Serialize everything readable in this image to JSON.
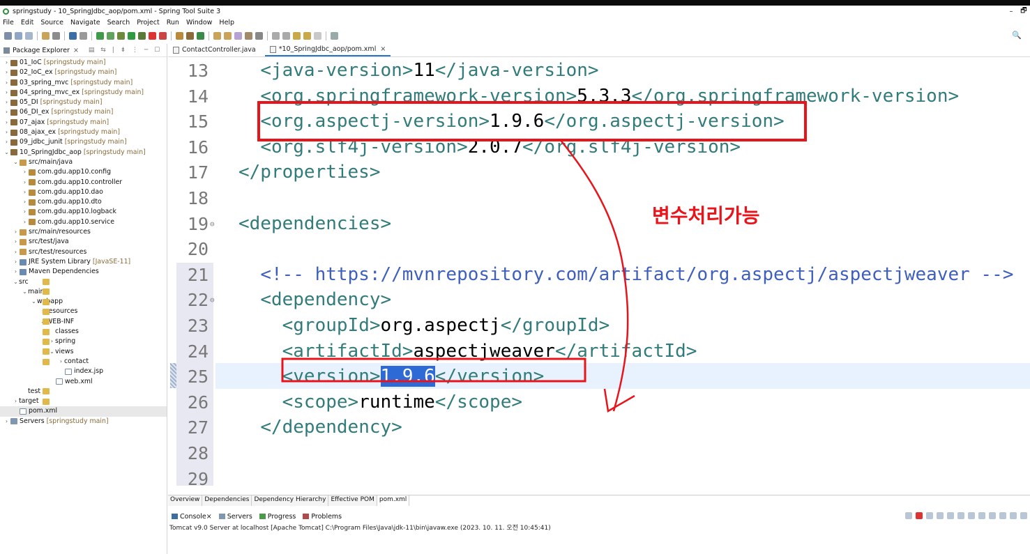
{
  "window": {
    "title": "springstudy - 10_SpringJdbc_aop/pom.xml - Spring Tool Suite 3",
    "minimize": "–",
    "restore": "🗗"
  },
  "menu": [
    "File",
    "Edit",
    "Source",
    "Navigate",
    "Search",
    "Project",
    "Run",
    "Window",
    "Help"
  ],
  "explorer": {
    "title": "Package Explorer",
    "tree": [
      {
        "label": "01_IoC",
        "tag": "[springstudy main]",
        "depth": 0,
        "icon": "project",
        "state": "collapsed"
      },
      {
        "label": "02_IoC_ex",
        "tag": "[springstudy main]",
        "depth": 0,
        "icon": "project",
        "state": "collapsed"
      },
      {
        "label": "03_spring_mvc",
        "tag": "[springstudy main]",
        "depth": 0,
        "icon": "project",
        "state": "collapsed"
      },
      {
        "label": "04_spring_mvc_ex",
        "tag": "[springstudy main]",
        "depth": 0,
        "icon": "project",
        "state": "collapsed"
      },
      {
        "label": "05_DI",
        "tag": "[springstudy main]",
        "depth": 0,
        "icon": "project",
        "state": "collapsed"
      },
      {
        "label": "06_DI_ex",
        "tag": "[springstudy main]",
        "depth": 0,
        "icon": "project",
        "state": "collapsed"
      },
      {
        "label": "07_ajax",
        "tag": "[springstudy main]",
        "depth": 0,
        "icon": "project",
        "state": "collapsed"
      },
      {
        "label": "08_ajax_ex",
        "tag": "[springstudy main]",
        "depth": 0,
        "icon": "project",
        "state": "collapsed"
      },
      {
        "label": "09_jdbc_junit",
        "tag": "[springstudy main]",
        "depth": 0,
        "icon": "project",
        "state": "collapsed"
      },
      {
        "label": "10_SpringJdbc_aop",
        "tag": "[springstudy main]",
        "depth": 0,
        "icon": "project",
        "state": "expanded"
      },
      {
        "label": "src/main/java",
        "tag": "",
        "depth": 1,
        "icon": "src",
        "state": "expanded"
      },
      {
        "label": "com.gdu.app10.config",
        "tag": "",
        "depth": 2,
        "icon": "package",
        "state": "collapsed"
      },
      {
        "label": "com.gdu.app10.controller",
        "tag": "",
        "depth": 2,
        "icon": "package",
        "state": "collapsed"
      },
      {
        "label": "com.gdu.app10.dao",
        "tag": "",
        "depth": 2,
        "icon": "package",
        "state": "collapsed"
      },
      {
        "label": "com.gdu.app10.dto",
        "tag": "",
        "depth": 2,
        "icon": "package",
        "state": "collapsed"
      },
      {
        "label": "com.gdu.app10.logback",
        "tag": "",
        "depth": 2,
        "icon": "package",
        "state": "collapsed"
      },
      {
        "label": "com.gdu.app10.service",
        "tag": "",
        "depth": 2,
        "icon": "package",
        "state": "collapsed"
      },
      {
        "label": "src/main/resources",
        "tag": "",
        "depth": 1,
        "icon": "src",
        "state": "collapsed"
      },
      {
        "label": "src/test/java",
        "tag": "",
        "depth": 1,
        "icon": "src",
        "state": "collapsed"
      },
      {
        "label": "src/test/resources",
        "tag": "",
        "depth": 1,
        "icon": "src",
        "state": "collapsed"
      },
      {
        "label": "JRE System Library",
        "tag": "[JavaSE-11]",
        "depth": 1,
        "icon": "library",
        "state": "collapsed"
      },
      {
        "label": "Maven Dependencies",
        "tag": "",
        "depth": 1,
        "icon": "library",
        "state": "collapsed"
      },
      {
        "label": "src",
        "tag": "",
        "depth": 1,
        "icon": "folder",
        "state": "expanded"
      },
      {
        "label": "main",
        "tag": "",
        "depth": 2,
        "icon": "folder",
        "state": "expanded"
      },
      {
        "label": "webapp",
        "tag": "",
        "depth": 3,
        "icon": "folder",
        "state": "expanded"
      },
      {
        "label": "resources",
        "tag": "",
        "depth": 4,
        "icon": "folder",
        "state": "collapsed"
      },
      {
        "label": "WEB-INF",
        "tag": "",
        "depth": 4,
        "icon": "folder",
        "state": "expanded"
      },
      {
        "label": "classes",
        "tag": "",
        "depth": 5,
        "icon": "folder",
        "state": "none"
      },
      {
        "label": "spring",
        "tag": "",
        "depth": 5,
        "icon": "folder",
        "state": "collapsed"
      },
      {
        "label": "views",
        "tag": "",
        "depth": 5,
        "icon": "folder",
        "state": "expanded"
      },
      {
        "label": "contact",
        "tag": "",
        "depth": 6,
        "icon": "folder",
        "state": "collapsed"
      },
      {
        "label": "index.jsp",
        "tag": "",
        "depth": 6,
        "icon": "file",
        "state": "none"
      },
      {
        "label": "web.xml",
        "tag": "",
        "depth": 5,
        "icon": "file",
        "state": "none"
      },
      {
        "label": "test",
        "tag": "",
        "depth": 2,
        "icon": "folder",
        "state": "none"
      },
      {
        "label": "target",
        "tag": "",
        "depth": 1,
        "icon": "folder",
        "state": "collapsed"
      },
      {
        "label": "pom.xml",
        "tag": "",
        "depth": 1,
        "icon": "file",
        "state": "none",
        "selected": true
      },
      {
        "label": "Servers",
        "tag": "[springstudy main]",
        "depth": 0,
        "icon": "server",
        "state": "collapsed"
      }
    ]
  },
  "editor": {
    "tabs": [
      {
        "label": "ContactController.java",
        "active": false
      },
      {
        "label": "*10_SpringJdbc_aop/pom.xml",
        "active": true
      }
    ],
    "lines": [
      {
        "n": "13",
        "indent": "  ",
        "fold": false,
        "parts": [
          [
            "tag",
            "<java-version>"
          ],
          [
            "txt",
            "11"
          ],
          [
            "tag",
            "</java-version>"
          ]
        ]
      },
      {
        "n": "14",
        "indent": "  ",
        "fold": false,
        "parts": [
          [
            "tag",
            "<org.springframework-version>"
          ],
          [
            "txt",
            "5.3.3"
          ],
          [
            "tag",
            "</org.springframework-version>"
          ]
        ]
      },
      {
        "n": "15",
        "indent": "  ",
        "fold": false,
        "parts": [
          [
            "tag",
            "<org.aspectj-version>"
          ],
          [
            "txt",
            "1.9.6"
          ],
          [
            "tag",
            "</org.aspectj-version>"
          ]
        ]
      },
      {
        "n": "16",
        "indent": "  ",
        "fold": false,
        "parts": [
          [
            "tag",
            "<org.slf4j-version>"
          ],
          [
            "txt",
            "2.0.7"
          ],
          [
            "tag",
            "</org.slf4j-version>"
          ]
        ]
      },
      {
        "n": "17",
        "indent": "",
        "fold": false,
        "parts": [
          [
            "tag",
            "</properties>"
          ]
        ]
      },
      {
        "n": "18",
        "indent": "",
        "fold": false,
        "parts": []
      },
      {
        "n": "19",
        "indent": "",
        "fold": true,
        "parts": [
          [
            "tag",
            "<dependencies>"
          ]
        ]
      },
      {
        "n": "20",
        "indent": "",
        "fold": false,
        "parts": []
      },
      {
        "n": "21",
        "indent": "  ",
        "fold": false,
        "parts": [
          [
            "cmt",
            "<!-- https://mvnrepository.com/artifact/org.aspectj/aspectjweaver -->"
          ]
        ]
      },
      {
        "n": "22",
        "indent": "  ",
        "fold": true,
        "parts": [
          [
            "tag",
            "<dependency>"
          ]
        ]
      },
      {
        "n": "23",
        "indent": "    ",
        "fold": false,
        "parts": [
          [
            "tag",
            "<groupId>"
          ],
          [
            "txt",
            "org.aspectj"
          ],
          [
            "tag",
            "</groupId>"
          ]
        ]
      },
      {
        "n": "24",
        "indent": "    ",
        "fold": false,
        "parts": [
          [
            "tag",
            "<artifactId>"
          ],
          [
            "txt",
            "aspectjweaver"
          ],
          [
            "tag",
            "</artifactId>"
          ]
        ]
      },
      {
        "n": "25",
        "indent": "    ",
        "fold": false,
        "parts": [
          [
            "tag",
            "<version>"
          ],
          [
            "hl",
            "1.9.6"
          ],
          [
            "tag",
            "</version>"
          ]
        ]
      },
      {
        "n": "26",
        "indent": "    ",
        "fold": false,
        "parts": [
          [
            "tag",
            "<scope>"
          ],
          [
            "txt",
            "runtime"
          ],
          [
            "tag",
            "</scope>"
          ]
        ]
      },
      {
        "n": "27",
        "indent": "  ",
        "fold": false,
        "parts": [
          [
            "tag",
            "</dependency>"
          ]
        ]
      },
      {
        "n": "28",
        "indent": "",
        "fold": false,
        "parts": []
      },
      {
        "n": "29",
        "indent": "",
        "fold": false,
        "parts": []
      }
    ],
    "bottom_tabs": [
      {
        "label": "Overview",
        "active": false
      },
      {
        "label": "Dependencies",
        "active": false
      },
      {
        "label": "Dependency Hierarchy",
        "active": false
      },
      {
        "label": "Effective POM",
        "active": false
      },
      {
        "label": "pom.xml",
        "active": true
      }
    ]
  },
  "console": {
    "tabs": [
      {
        "label": "Console",
        "icon": "console-icon",
        "close": true
      },
      {
        "label": "Servers",
        "icon": "servers-icon"
      },
      {
        "label": "Progress",
        "icon": "progress-icon"
      },
      {
        "label": "Problems",
        "icon": "problems-icon"
      }
    ],
    "text": "Tomcat v9.0 Server at localhost [Apache Tomcat] C:\\Program Files\\Java\\jdk-11\\bin\\javaw.exe  (2023. 10. 11. 오전 10:45:41)"
  },
  "annotation": {
    "text": "변수처리가능",
    "color": "#e8141a"
  }
}
